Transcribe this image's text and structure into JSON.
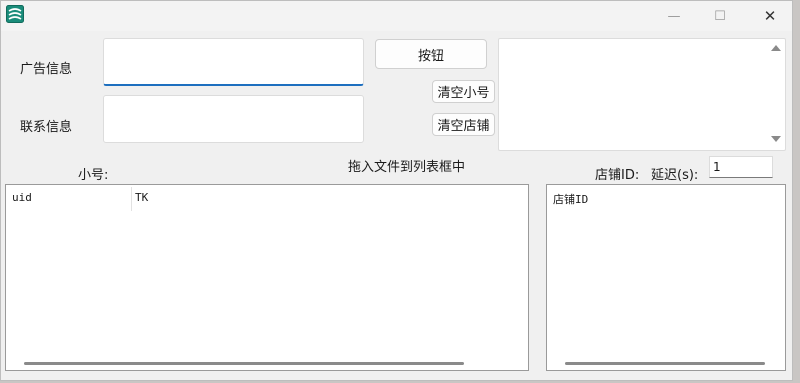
{
  "window": {
    "controls": {
      "minimize": "—",
      "maximize": "☐",
      "close": "✕"
    }
  },
  "form": {
    "ad_info_label": "广告信息",
    "ad_info_value": "",
    "contact_label": "联系信息",
    "contact_value": "",
    "button_label": "按钮",
    "clear_accounts_label": "清空小号",
    "clear_shops_label": "清空店铺",
    "memo_value": ""
  },
  "lists": {
    "accounts_label": "小号:",
    "drag_hint": "拖入文件到列表框中",
    "shop_id_label": "店铺ID:",
    "delay_label": "延迟(s):",
    "delay_value": "1",
    "accounts_columns": [
      "uid",
      "TK"
    ],
    "shops_columns": [
      "店铺ID"
    ]
  },
  "colors": {
    "accent": "#1d6fbf",
    "window_bg": "#f0f0f0",
    "list_border": "#9a9a9a"
  }
}
